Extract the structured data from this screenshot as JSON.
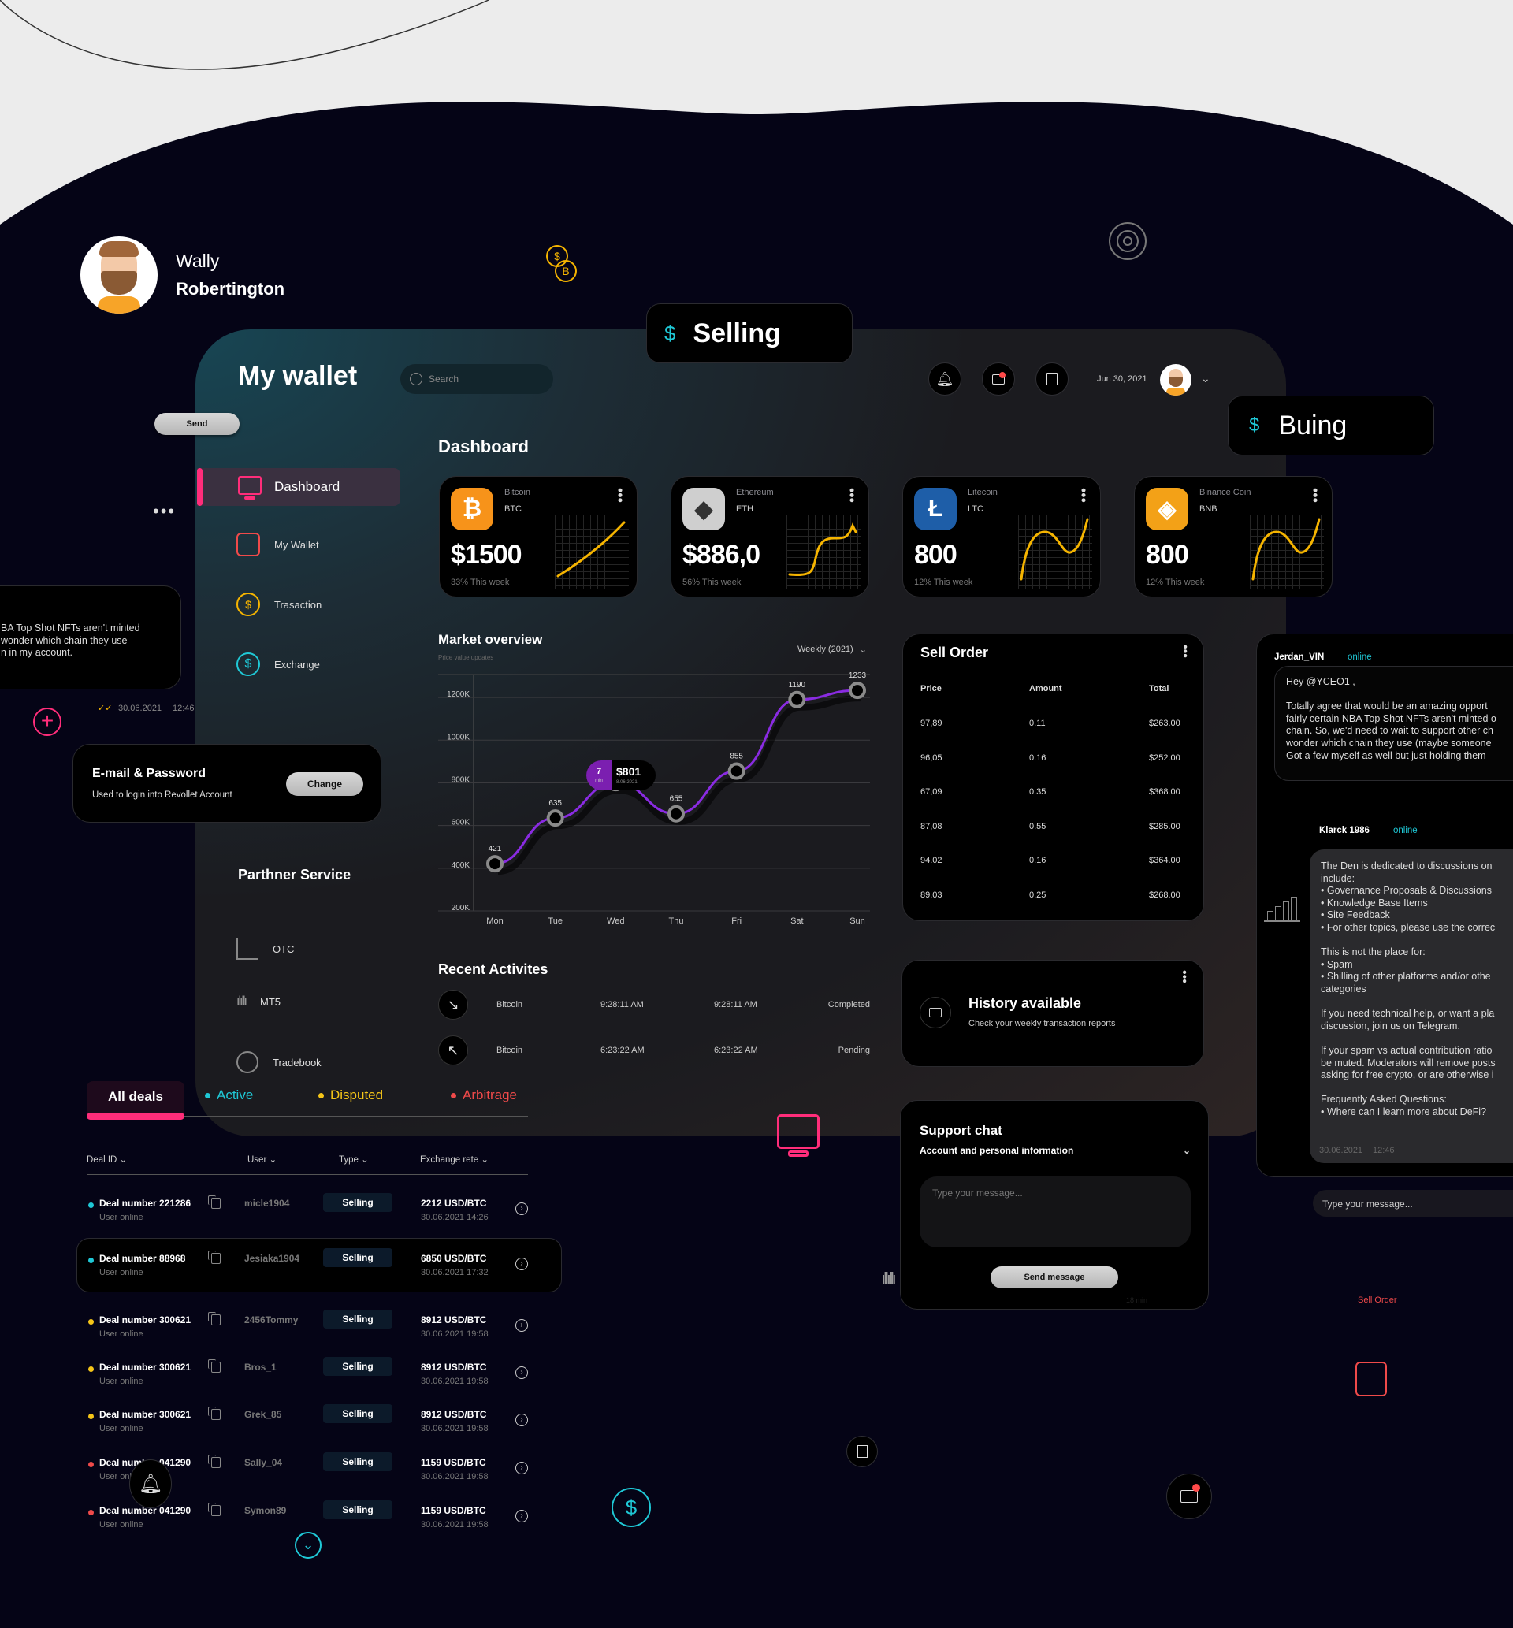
{
  "profile": {
    "first_name": "Wally",
    "last_name": "Robertington"
  },
  "wallet": {
    "title": "My wallet",
    "search_placeholder": "Search",
    "send_label": "Send",
    "header_date": "Jun 30, 2021",
    "header_icons": [
      "bell-icon",
      "chat-icon",
      "gift-icon"
    ],
    "section_title": "Dashboard"
  },
  "floating": {
    "selling_label": "Selling",
    "buying_label": "Buing",
    "sell_order_link": "Sell Order"
  },
  "sidebar": {
    "items": [
      {
        "label": "Dashboard",
        "icon": "monitor-chart-icon",
        "active": true
      },
      {
        "label": "My Wallet",
        "icon": "wallet-icon",
        "active": false
      },
      {
        "label": "Trasaction",
        "icon": "coins-icon",
        "active": false
      },
      {
        "label": "Exchange",
        "icon": "exchange-icon",
        "active": false
      }
    ],
    "partner_title": "Parthner Service",
    "partners": [
      {
        "label": "OTC",
        "icon": "growth-chart-icon"
      },
      {
        "label": "MT5",
        "icon": "soundwave-icon"
      },
      {
        "label": "Tradebook",
        "icon": "dial-icon"
      }
    ]
  },
  "email_card": {
    "title": "E-mail & Password",
    "subtitle": "Used to login into Revollet Account",
    "button": "Change"
  },
  "left_chat": {
    "text": "BA Top Shot NFTs aren't minted\nwonder which chain they use\nn in my account.",
    "date": "30.06.2021",
    "time": "12:46"
  },
  "coins": [
    {
      "name": "Bitcoin",
      "symbol": "BTC",
      "value": "$1500",
      "change": "33% This week",
      "color": "#F7931A",
      "glyph": "₿"
    },
    {
      "name": "Ethereum",
      "symbol": "ETH",
      "value": "$886,0",
      "change": "56% This week",
      "color": "#cfcfcf",
      "glyph": "◆"
    },
    {
      "name": "Litecoin",
      "symbol": "LTC",
      "value": "800",
      "change": "12% This week",
      "color": "#1e5ea8",
      "glyph": "Ł"
    },
    {
      "name": "Binance Coin",
      "symbol": "BNB",
      "value": "800",
      "change": "12% This week",
      "color": "#F3A117",
      "glyph": "◈"
    }
  ],
  "market": {
    "title": "Market overview",
    "subtitle": "Price value updates",
    "period": "Weekly (2021)",
    "tooltip": {
      "minutes": "7",
      "unit": "min",
      "value": "$801",
      "date": "8.06.2021"
    }
  },
  "chart_data": {
    "type": "line",
    "title": "Market overview",
    "categories": [
      "Mon",
      "Tue",
      "Wed",
      "Thu",
      "Fri",
      "Sat",
      "Sun"
    ],
    "values": [
      421,
      635,
      801,
      655,
      855,
      1190,
      1233
    ],
    "point_labels": [
      "421",
      "635",
      "",
      "655",
      "855",
      "1190",
      "1233"
    ],
    "y_ticks": [
      "200K",
      "400K",
      "600K",
      "800K",
      "1000K",
      "1200K"
    ],
    "ylim": [
      200,
      1300
    ],
    "xlabel": "",
    "ylabel": "",
    "grid": true,
    "series_color": "#8a2be2"
  },
  "recent": {
    "title": "Recent Activites",
    "rows": [
      {
        "dir": "down",
        "coin": "Bitcoin",
        "time1": "9:28:11 AM",
        "time2": "9:28:11 AM",
        "status": "Completed"
      },
      {
        "dir": "up",
        "coin": "Bitcoin",
        "time1": "6:23:22 AM",
        "time2": "6:23:22 AM",
        "status": "Pending"
      }
    ]
  },
  "sell_order": {
    "title": "Sell Order",
    "headers": [
      "Price",
      "Amount",
      "Total"
    ],
    "rows": [
      [
        "97,89",
        "0.11",
        "$263.00"
      ],
      [
        "96,05",
        "0.16",
        "$252.00"
      ],
      [
        "67,09",
        "0.35",
        "$368.00"
      ],
      [
        "87,08",
        "0.55",
        "$285.00"
      ],
      [
        "94.02",
        "0.16",
        "$364.00"
      ],
      [
        "89.03",
        "0.25",
        "$268.00"
      ]
    ]
  },
  "history": {
    "title": "History available",
    "subtitle": "Check your weekly transaction reports"
  },
  "support": {
    "title": "Support chat",
    "topic": "Account and personal information",
    "placeholder": "Type your message...",
    "button": "Send message",
    "footnote": "18 min"
  },
  "chat": {
    "user1": "Jerdan_VIN",
    "status1": "online",
    "msg1": "Hey @YCEO1 ,\n\nTotally agree that would be an amazing opport\nfairly certain NBA Top Shot NFTs aren't minted o\nchain. So, we'd need to wait to support other ch\nwonder which chain they use (maybe someone\nGot a few myself as well but just holding them",
    "user2": "Klarck 1986",
    "status2": "online",
    "msg2": "The Den is dedicated to discussions on\ninclude:\n• Governance Proposals & Discussions\n• Knowledge Base Items\n• Site Feedback\n• For other topics, please use the correc\n\nThis is not the place for:\n• Spam\n• Shilling of other platforms and/or othe\ncategories\n\nIf you need technical help, or want a pla\ndiscussion, join us on Telegram.\n\nIf your spam vs actual contribution ratio\nbe muted. Moderators will remove posts\nasking for free crypto, or are otherwise i\n\nFrequently Asked Questions:\n• Where can I learn more about DeFi?",
    "date": "30.06.2021",
    "time": "12:46",
    "input_placeholder": "Type your message..."
  },
  "deals": {
    "tabs": [
      {
        "label": "All deals",
        "color": "#ffffff",
        "active": true
      },
      {
        "label": "Active",
        "color": "#1fc8d6"
      },
      {
        "label": "Disputed",
        "color": "#f5c518"
      },
      {
        "label": "Arbitrage",
        "color": "#f04a4a"
      }
    ],
    "columns": [
      "Deal ID",
      "User",
      "Type",
      "Exchange rete"
    ],
    "rows": [
      {
        "id": "Deal number 221286",
        "status": "User online",
        "user": "micle1904",
        "type": "Selling",
        "rate": "2212 USD/BTC",
        "date": "30.06.2021 14:26",
        "dot": "#1fc8d6"
      },
      {
        "id": "Deal number 88968",
        "status": "User online",
        "user": "Jesiaka1904",
        "type": "Selling",
        "rate": "6850 USD/BTC",
        "date": "30.06.2021 17:32",
        "dot": "#1fc8d6"
      },
      {
        "id": "Deal number 300621",
        "status": "User online",
        "user": "2456Tommy",
        "type": "Selling",
        "rate": "8912 USD/BTC",
        "date": "30.06.2021 19:58",
        "dot": "#f5c518"
      },
      {
        "id": "Deal number 300621",
        "status": "User online",
        "user": "Bros_1",
        "type": "Selling",
        "rate": "8912 USD/BTC",
        "date": "30.06.2021 19:58",
        "dot": "#f5c518"
      },
      {
        "id": "Deal number 300621",
        "status": "User online",
        "user": "Grek_85",
        "type": "Selling",
        "rate": "8912 USD/BTC",
        "date": "30.06.2021 19:58",
        "dot": "#f5c518"
      },
      {
        "id": "Deal number 041290",
        "status": "User online",
        "user": "Sally_04",
        "type": "Selling",
        "rate": "1159 USD/BTC",
        "date": "30.06.2021 19:58",
        "dot": "#f04a4a"
      },
      {
        "id": "Deal number 041290",
        "status": "User online",
        "user": "Symon89",
        "type": "Selling",
        "rate": "1159 USD/BTC",
        "date": "30.06.2021 19:58",
        "dot": "#f04a4a"
      }
    ]
  },
  "colors": {
    "accent_pink": "#ff2d7a",
    "accent_cyan": "#1fc8d6",
    "accent_yellow": "#f5c518",
    "accent_red": "#f04a4a",
    "purple": "#8a2be2",
    "bg": "#050416"
  }
}
